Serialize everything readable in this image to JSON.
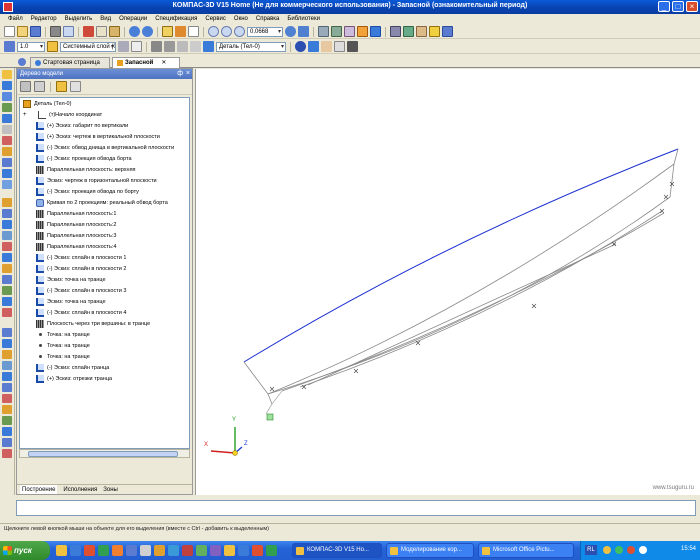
{
  "window": {
    "title": "КОМПАС-3D V15 Home (Не для коммерческого использования) - Запасной (ознакомительный период)",
    "controls": {
      "minimize": "_",
      "maximize": "□",
      "close": "×"
    }
  },
  "menu": [
    "Файл",
    "Редактор",
    "Выделить",
    "Вид",
    "Операции",
    "Спецификация",
    "Сервис",
    "Окно",
    "Справка",
    "Библиотеки"
  ],
  "toolbar": {
    "zoom_value": "0.0668",
    "scale_value": "1.0",
    "layer_value": "Системный слой (0)",
    "part_value": "Деталь (Тел-0)"
  },
  "tabs": [
    {
      "label": "Стартовая страница"
    },
    {
      "label": "Запасной"
    }
  ],
  "panel": {
    "title": "Дерево модели",
    "pin": "ф",
    "close": "×",
    "root": "Деталь (Тел-0)",
    "items": [
      {
        "label": "(т)Начало координат",
        "icon": "origin"
      },
      {
        "label": "(+) Эскиз: габарит по вертикали",
        "icon": "sketch"
      },
      {
        "label": "(+) Эскиз: чертеж в вертикальной плоскости",
        "icon": "sketch"
      },
      {
        "label": "(-) Эскиз: обвод днища в вертикальной плоскости",
        "icon": "sketch"
      },
      {
        "label": "(-) Эскиз: проекция обвода борта",
        "icon": "sketch"
      },
      {
        "label": "Параллельная плоскость: верхняя",
        "icon": "plane"
      },
      {
        "label": "Эскиз: чертеж в горизонтальной плоскости",
        "icon": "sketch"
      },
      {
        "label": "(-) Эскиз: проекция обвода по борту",
        "icon": "sketch"
      },
      {
        "label": "Кривая по 2 проекциям: реальный обвод борта",
        "icon": "curve"
      },
      {
        "label": "Параллельная плоскость:1",
        "icon": "plane"
      },
      {
        "label": "Параллельная плоскость:2",
        "icon": "plane"
      },
      {
        "label": "Параллельная плоскость:3",
        "icon": "plane"
      },
      {
        "label": "Параллельная плоскость:4",
        "icon": "plane"
      },
      {
        "label": "(-) Эскиз: сплайн в плоскости 1",
        "icon": "sketch"
      },
      {
        "label": "(-) Эскиз: сплайн в плоскости 2",
        "icon": "sketch"
      },
      {
        "label": "Эскиз: точка на транце",
        "icon": "sketch"
      },
      {
        "label": "(-) Эскиз: сплайн в плоскости 3",
        "icon": "sketch"
      },
      {
        "label": "Эскиз: точка на транце",
        "icon": "sketch"
      },
      {
        "label": "(-) Эскиз: сплайн в плоскости 4",
        "icon": "sketch"
      },
      {
        "label": "Плоскость через три вершины: в транце",
        "icon": "plane"
      },
      {
        "label": "Точка: на транце",
        "icon": "point"
      },
      {
        "label": "Точка: на транце",
        "icon": "point"
      },
      {
        "label": "Точка: на транце",
        "icon": "point"
      },
      {
        "label": "(-) Эскиз: сплайн транца",
        "icon": "sketch"
      },
      {
        "label": "(+) Эскиз: отрезки транца",
        "icon": "sketch"
      }
    ],
    "bottom_tabs": [
      "Построение",
      "Исполнения",
      "Зоны"
    ]
  },
  "viewport": {
    "watermark": "www.tsuguru.ru",
    "axes": {
      "x": "X",
      "y": "Y",
      "z": "Z"
    }
  },
  "status": "Щелкните левой кнопкой мыши на объекте для его выделения (вместе с Ctrl - добавить к выделенным)",
  "taskbar": {
    "start": "пуск",
    "buttons": [
      "КОМПАС-3D V15 Ho...",
      "Моделирование кор...",
      "Microsoft Office Pictu..."
    ],
    "lang": "RL",
    "clock": "15:54"
  }
}
